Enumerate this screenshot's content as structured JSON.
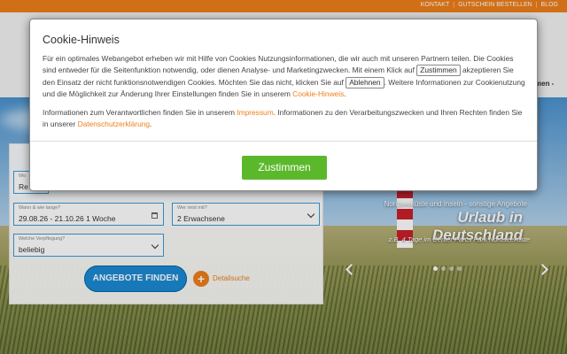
{
  "toplinks": [
    "KONTAKT",
    "GUTSCHEIN BESTELLEN",
    "BLOG"
  ],
  "nav": {
    "visible_fragment": "men -"
  },
  "form": {
    "destination": {
      "label": "Wo",
      "value": "Re"
    },
    "dates": {
      "label": "Wann & wie lange?",
      "value": "29.08.26 - 21.10.26  1 Woche"
    },
    "travellers": {
      "label": "Wer reist mit?",
      "value": "2 Erwachsene"
    },
    "board": {
      "label": "Welche Verpflegung?",
      "value": "beliebig"
    },
    "search_button": "ANGEBOTE FINDEN",
    "detail_link": "Detailsuche"
  },
  "hero": {
    "eyebrow": "Nordseeküste und Inseln - sonstige Angebote",
    "title": "Urlaub in Deutschland",
    "subtitle": "z.B. 4 Tage im Center Parcs Park Nordseeküste",
    "slide_count": 4,
    "active_slide": 1
  },
  "cookie_modal": {
    "title": "Cookie-Hinweis",
    "p1_a": "Für ein optimales Webangebot erheben wir mit Hilfe von Cookies Nutzungsinformationen, die wir auch mit unseren Partnern teilen. Die Cookies sind entweder für die Seitenfunktion notwendig, oder dienen Analyse- und Marketingzwecken. Mit einem Klick auf",
    "inline_accept": "Zustimmen",
    "p1_b": "akzeptieren Sie den Einsatz der nicht funktionsnotwendigen Cookies. Möchten Sie das nicht, klicken Sie auf",
    "inline_decline": "Ablehnen",
    "p1_c": ". Weitere Informationen zur Cookienutzung und die Möglichkeit zur Änderung Ihrer Einstellungen finden Sie in unserem",
    "cookie_link": "Cookie-Hinweis",
    "p1_d": ".",
    "p2_a": "Informationen zum Verantwortlichen finden Sie in unserem",
    "impressum_link": "Impressum",
    "p2_b": ". Informationen zu den Verarbeitungszwecken und Ihren Rechten finden Sie in unserer",
    "privacy_link": "Datenschutzerklärung",
    "p2_c": ".",
    "accept_button": "Zustimmen"
  },
  "colors": {
    "brand_orange": "#ee7f1a",
    "accent_blue": "#1b8ad3",
    "accept_green": "#5cb82b"
  }
}
